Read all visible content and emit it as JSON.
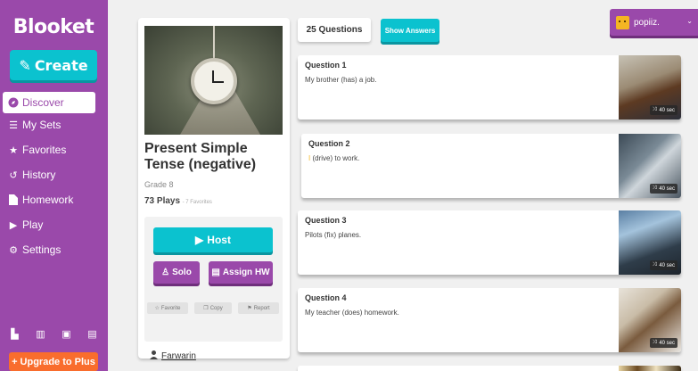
{
  "sidebar": {
    "logo": "Blooket",
    "create_label": "Create",
    "items": [
      {
        "label": "Discover",
        "icon": "compass-icon"
      },
      {
        "label": "My Sets",
        "icon": "list-icon"
      },
      {
        "label": "Favorites",
        "icon": "star-icon"
      },
      {
        "label": "History",
        "icon": "history-icon"
      },
      {
        "label": "Homework",
        "icon": "file-icon"
      },
      {
        "label": "Play",
        "icon": "play-icon"
      },
      {
        "label": "Settings",
        "icon": "gear-icon"
      }
    ],
    "bottom_icons": [
      "stats-icon",
      "market-icon",
      "inventory-icon",
      "news-icon"
    ],
    "upgrade_label": "Upgrade to Plus"
  },
  "set": {
    "title": "Present Simple Tense (negative)",
    "grade": "Grade 8",
    "plays": "73 Plays",
    "favorites": "- 7 Favorites",
    "host_label": "Host",
    "solo_label": "Solo",
    "assign_label": "Assign HW",
    "favorite_label": "Favorite",
    "copy_label": "Copy",
    "report_label": "Report",
    "author": "Farwarin"
  },
  "questions_header": {
    "count_label": "25 Questions",
    "show_answers_label": "Show Answers"
  },
  "user": {
    "name": "popiiz."
  },
  "questions": [
    {
      "label": "Question 1",
      "pre": "",
      "highlight": "",
      "text": "My brother (has) a job.",
      "time": "40 sec"
    },
    {
      "label": "Question 2",
      "pre": "",
      "highlight": "I",
      "text": " (drive) to work.",
      "time": "40 sec"
    },
    {
      "label": "Question 3",
      "pre": "",
      "highlight": "",
      "text": "Pilots (fix) planes.",
      "time": "40 sec"
    },
    {
      "label": "Question 4",
      "pre": "",
      "highlight": "",
      "text": "My teacher (does) homework.",
      "time": "40 sec"
    }
  ],
  "colors": {
    "brand_purple": "#9a49aa",
    "accent_cyan": "#0bc2cf",
    "upgrade_orange": "#f96d2d",
    "highlight_yellow": "#f4b622"
  }
}
